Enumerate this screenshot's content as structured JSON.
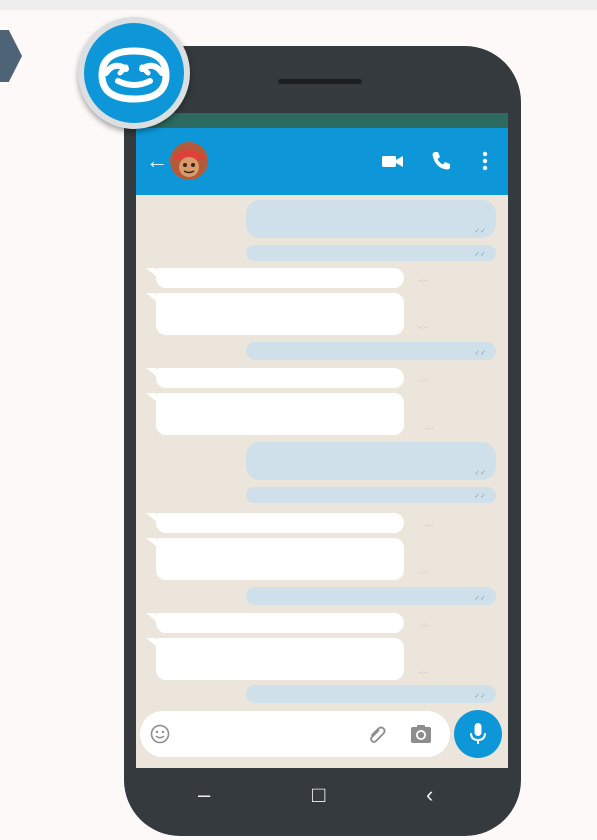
{
  "colors": {
    "background": "#fdf9f9",
    "phone_body": "#343a3d",
    "status_bar": "#2d6a5f",
    "app_bar": "#0e97d8",
    "chat_background": "#ece5dc",
    "outgoing_bubble": "#cfe0ea",
    "incoming_bubble": "#ffffff",
    "mic_button": "#0e97d8"
  },
  "logo": {
    "icon": "sloth-face-logo"
  },
  "app_bar": {
    "back_icon": "arrow-left-icon",
    "avatar_icon": "contact-avatar",
    "actions": [
      "video-call-icon",
      "phone-call-icon",
      "more-vert-icon"
    ]
  },
  "input_bar": {
    "emoji_icon": "emoji-icon",
    "attach_icon": "paperclip-icon",
    "camera_icon": "camera-icon",
    "mic_icon": "mic-icon"
  },
  "nav_bar": {
    "recent_label": "–",
    "home_label": "□",
    "back_label": "‹"
  }
}
